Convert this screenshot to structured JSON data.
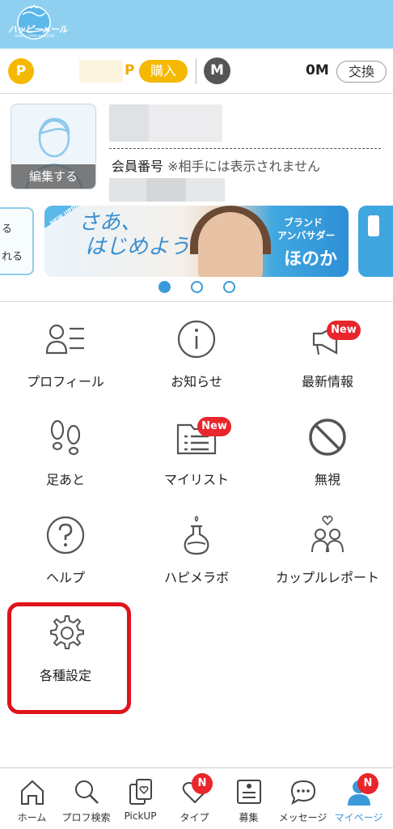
{
  "header": {
    "logo_text": "ハッピーメール",
    "logo_sub": "HAPPY COMMUNICATION"
  },
  "points": {
    "p_badge": "P",
    "p_unit": "P",
    "buy_label": "購入",
    "m_badge": "M",
    "m_value": "0M",
    "exchange_label": "交換"
  },
  "profile": {
    "edit_label": "編集する",
    "member_label": "会員番号",
    "member_note": "※相手には表示されません"
  },
  "banners": {
    "left_line1": "る",
    "left_line2": "れる",
    "new_tag": "NEW UPDATE",
    "script_line1": "さあ、",
    "script_line2": "はじめよう",
    "brand_line1": "ブランド",
    "brand_line2": "アンバサダー",
    "ambassador_name": "ほのか",
    "pager": {
      "total": 3,
      "active": 1
    }
  },
  "menu": {
    "items": [
      {
        "label": "プロフィール",
        "icon": "profile-list-icon",
        "badge": ""
      },
      {
        "label": "お知らせ",
        "icon": "info-icon",
        "badge": ""
      },
      {
        "label": "最新情報",
        "icon": "megaphone-icon",
        "badge": "New"
      },
      {
        "label": "足あと",
        "icon": "footprints-icon",
        "badge": ""
      },
      {
        "label": "マイリスト",
        "icon": "folder-list-icon",
        "badge": "New"
      },
      {
        "label": "無視",
        "icon": "block-icon",
        "badge": ""
      },
      {
        "label": "ヘルプ",
        "icon": "help-icon",
        "badge": ""
      },
      {
        "label": "ハピメラボ",
        "icon": "flask-icon",
        "badge": ""
      },
      {
        "label": "カップルレポート",
        "icon": "couple-icon",
        "badge": ""
      },
      {
        "label": "各種設定",
        "icon": "gear-icon",
        "badge": ""
      }
    ],
    "highlighted": "各種設定"
  },
  "bottom_nav": {
    "items": [
      {
        "label": "ホーム",
        "icon": "home-icon",
        "badge": ""
      },
      {
        "label": "プロフ検索",
        "icon": "search-icon",
        "badge": ""
      },
      {
        "label": "PickUP",
        "icon": "pickup-cards-icon",
        "badge": ""
      },
      {
        "label": "タイプ",
        "icon": "heart-icon",
        "badge": "N"
      },
      {
        "label": "募集",
        "icon": "board-icon",
        "badge": ""
      },
      {
        "label": "メッセージ",
        "icon": "chat-bubble-icon",
        "badge": ""
      },
      {
        "label": "マイページ",
        "icon": "person-icon",
        "badge": "N"
      }
    ],
    "active": "マイページ",
    "active_color": "#3a9ad9"
  },
  "colors": {
    "header_bg": "#8fd0f0",
    "point_yellow": "#f5b800",
    "badge_red": "#e8262c",
    "highlight_red": "#e0131c"
  }
}
